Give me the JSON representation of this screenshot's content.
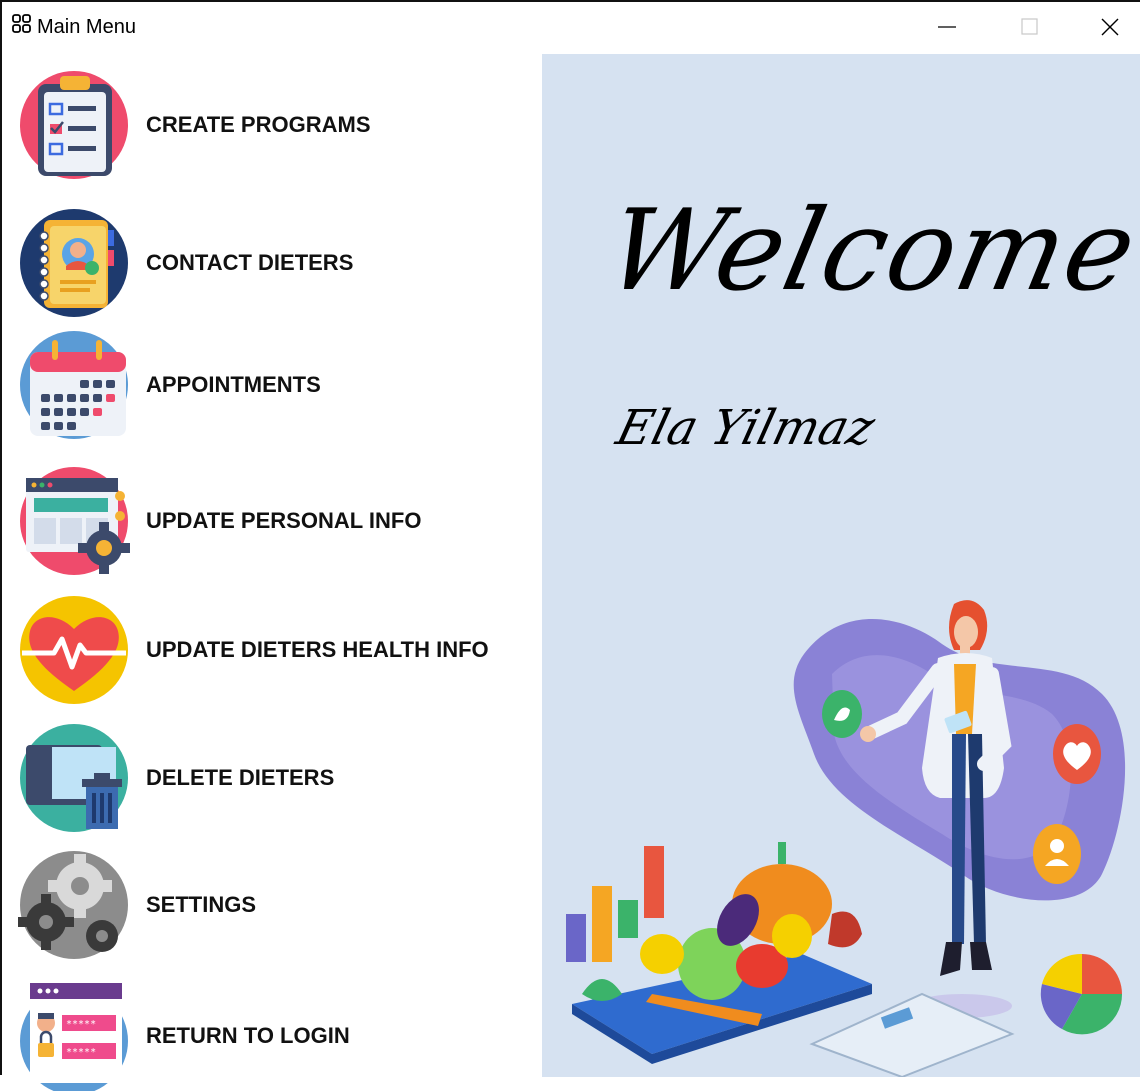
{
  "window": {
    "title": "Main Menu",
    "icons": {
      "app": "grid-icon",
      "minimize": "minimize-icon",
      "maximize": "maximize-icon",
      "close": "close-icon"
    }
  },
  "menu": {
    "items": [
      {
        "label": "CREATE PROGRAMS",
        "icon": "clipboard-checklist-icon"
      },
      {
        "label": "CONTACT DIETERS",
        "icon": "address-book-icon"
      },
      {
        "label": "APPOINTMENTS",
        "icon": "calendar-icon"
      },
      {
        "label": "UPDATE PERSONAL INFO",
        "icon": "browser-settings-icon"
      },
      {
        "label": "UPDATE DIETERS HEALTH INFO",
        "icon": "heart-rate-icon"
      },
      {
        "label": "DELETE DIETERS",
        "icon": "trash-icon"
      },
      {
        "label": "SETTINGS",
        "icon": "gears-icon"
      },
      {
        "label": "RETURN TO LOGIN",
        "icon": "login-form-icon"
      }
    ]
  },
  "welcome_panel": {
    "greeting": "Welcome",
    "user_name": "Ela Yilmaz",
    "illustration": "dietitian-with-vegetables-illustration",
    "background": "#d6e2f1"
  }
}
